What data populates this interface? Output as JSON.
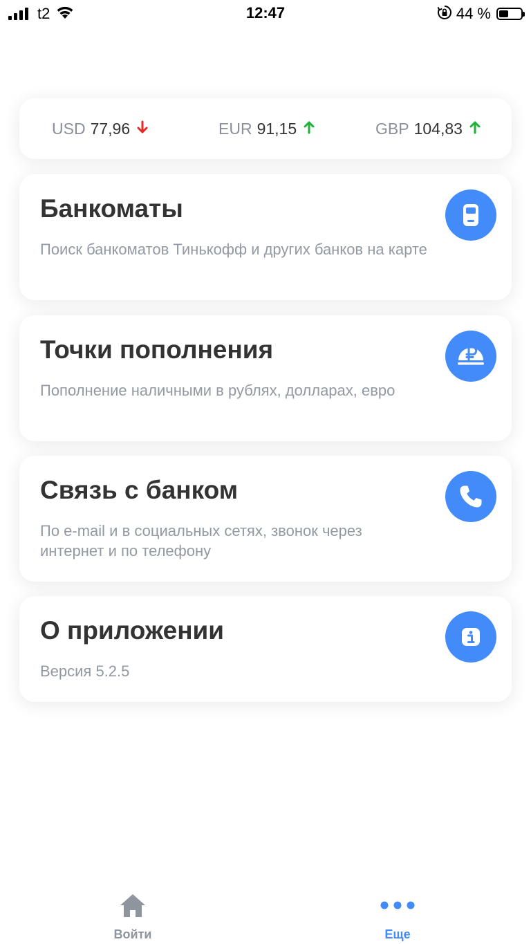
{
  "status_bar": {
    "carrier": "t2",
    "time": "12:47",
    "battery_percent": "44 %",
    "battery_level": 0.44
  },
  "rates": [
    {
      "code": "USD",
      "value": "77,96",
      "trend": "down"
    },
    {
      "code": "EUR",
      "value": "91,15",
      "trend": "up"
    },
    {
      "code": "GBP",
      "value": "104,83",
      "trend": "up"
    }
  ],
  "menu": {
    "atms": {
      "title": "Банкоматы",
      "subtitle": "Поиск банкоматов Тинькофф и других банков на карте",
      "icon": "atm-icon"
    },
    "topup": {
      "title": "Точки пополнения",
      "subtitle": "Пополнение наличными в рублях, долларах, евро",
      "icon": "ruble-coin-icon"
    },
    "contact": {
      "title": "Связь с банком",
      "subtitle": "По e-mail и в социальных сетях, звонок через интернет и по телефону",
      "icon": "phone-icon"
    },
    "about": {
      "title": "О приложении",
      "subtitle": "Версия 5.2.5",
      "icon": "info-icon"
    }
  },
  "tabs": {
    "login": {
      "label": "Войти",
      "icon": "home-icon"
    },
    "more": {
      "label": "Еще",
      "icon": "more-dots-icon"
    }
  },
  "colors": {
    "accent": "#428bf9",
    "trend_up": "#1db33b",
    "trend_down": "#e5282a",
    "tab_inactive": "#8f959e",
    "tab_active": "#428bf9"
  }
}
